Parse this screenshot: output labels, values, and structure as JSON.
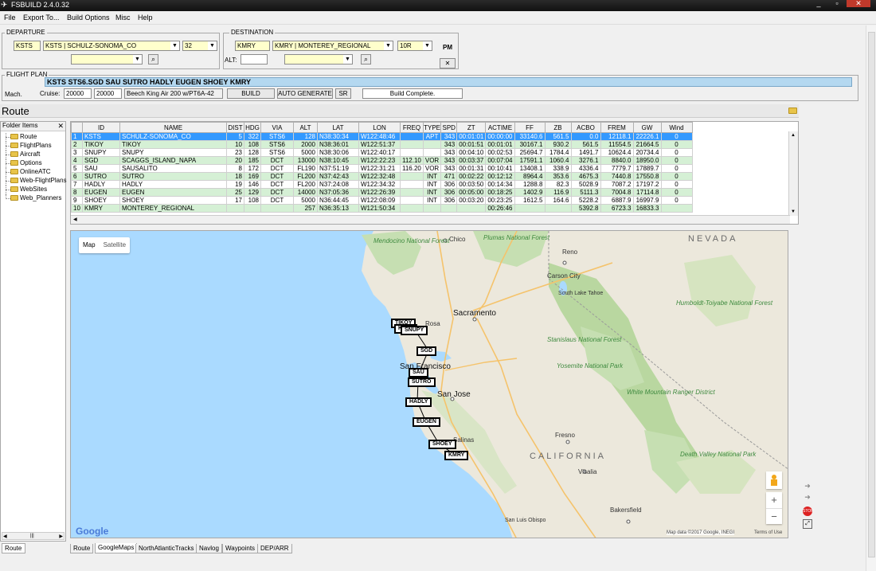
{
  "window": {
    "title": "FSBUILD 2.4.0.32"
  },
  "menu": [
    "File",
    "Export To...",
    "Build Options",
    "Misc",
    "Help"
  ],
  "departure": {
    "legend": "DEPARTURE",
    "code": "KSTS",
    "airport": "KSTS | SCHULZ-SONOMA_CO",
    "runway": "32",
    "sid": ""
  },
  "destination": {
    "legend": "DESTINATION",
    "code": "KMRY",
    "airport": "KMRY | MONTEREY_REGIONAL",
    "runway": "10R",
    "star": "",
    "alt_label": "ALT:",
    "alt_value": "",
    "pm_label": "PM",
    "close_label": "✕"
  },
  "flightplan": {
    "legend": "FLIGHT PLAN",
    "route": "KSTS STS6.SGD SAU SUTRO HADLY EUGEN SHOEY KMRY",
    "mach_label": "Mach.",
    "cruise_label": "Cruise:",
    "cruise_alt1": "20000",
    "cruise_alt2": "20000",
    "aircraft": "Beech King Air 200 w/PT6A-42",
    "build_label": "BUILD",
    "autogen_label": "AUTO GENERATE",
    "sr_label": "SR",
    "status": "Build Complete."
  },
  "route_panel": {
    "title": "Route"
  },
  "folders": {
    "header": "Folder Items",
    "close": "✕",
    "items": [
      "Route",
      "FlightPlans",
      "Aircraft",
      "Options",
      "OnlineATC",
      "Web-FlightPlans",
      "WebSites",
      "Web_Planners"
    ],
    "bottom_tab": "Route"
  },
  "nav_table": {
    "columns": [
      "",
      "ID",
      "NAME",
      "DIST",
      "HDG",
      "VIA",
      "ALT",
      "LAT",
      "LON",
      "FREQ",
      "TYPE",
      "SPD",
      "ZT",
      "ACTIME",
      "FF",
      "ZB",
      "ACBO",
      "FREM",
      "GW",
      "Wind"
    ],
    "rows": [
      [
        "1",
        "KSTS",
        "SCHULZ-SONOMA_CO",
        "5",
        "322",
        "STS6",
        "128",
        "N38:30:34",
        "W122:48:46",
        "",
        "APT",
        "343",
        "00:01:01",
        "00:00:00",
        "33140.6",
        "561.5",
        "0.0",
        "12118.1",
        "22226.1",
        "0"
      ],
      [
        "2",
        "TIKOY",
        "TIKOY",
        "10",
        "108",
        "STS6",
        "2000",
        "N38:36:01",
        "W122:51:37",
        "",
        "",
        "343",
        "00:01:51",
        "00:01:01",
        "30167.1",
        "930.2",
        "561.5",
        "11554.5",
        "21664.5",
        "0"
      ],
      [
        "3",
        "SNUPY",
        "SNUPY",
        "23",
        "128",
        "STS6",
        "5000",
        "N38:30:06",
        "W122:40:17",
        "",
        "",
        "343",
        "00:04:10",
        "00:02:53",
        "25694.7",
        "1784.4",
        "1491.7",
        "10624.4",
        "20734.4",
        "0"
      ],
      [
        "4",
        "SGD",
        "SCAGGS_ISLAND_NAPA",
        "20",
        "185",
        "DCT",
        "13000",
        "N38:10:45",
        "W122:22:23",
        "112.10",
        "VOR",
        "343",
        "00:03:37",
        "00:07:04",
        "17591.1",
        "1060.4",
        "3276.1",
        "8840.0",
        "18950.0",
        "0"
      ],
      [
        "5",
        "SAU",
        "SAUSALITO",
        "8",
        "172",
        "DCT",
        "FL190",
        "N37:51:19",
        "W122:31:21",
        "116.20",
        "VOR",
        "343",
        "00:01:31",
        "00:10:41",
        "13408.1",
        "338.9",
        "4336.4",
        "7779.7",
        "17889.7",
        "0"
      ],
      [
        "6",
        "SUTRO",
        "SUTRO",
        "18",
        "169",
        "DCT",
        "FL200",
        "N37:42:43",
        "W122:32:48",
        "",
        "INT",
        "471",
        "00:02:22",
        "00:12:12",
        "8964.4",
        "353.6",
        "4675.3",
        "7440.8",
        "17550.8",
        "0"
      ],
      [
        "7",
        "HADLY",
        "HADLY",
        "19",
        "146",
        "DCT",
        "FL200",
        "N37:24:08",
        "W122:34:32",
        "",
        "INT",
        "306",
        "00:03:50",
        "00:14:34",
        "1288.8",
        "82.3",
        "5028.9",
        "7087.2",
        "17197.2",
        "0"
      ],
      [
        "8",
        "EUGEN",
        "EUGEN",
        "25",
        "129",
        "DCT",
        "14000",
        "N37:05:36",
        "W122:26:39",
        "",
        "INT",
        "306",
        "00:05:00",
        "00:18:25",
        "1402.9",
        "116.9",
        "5111.3",
        "7004.8",
        "17114.8",
        "0"
      ],
      [
        "9",
        "SHOEY",
        "SHOEY",
        "17",
        "108",
        "DCT",
        "5000",
        "N36:44:45",
        "W122:08:09",
        "",
        "INT",
        "306",
        "00:03:20",
        "00:23:25",
        "1612.5",
        "164.6",
        "5228.2",
        "6887.9",
        "16997.9",
        "0"
      ],
      [
        "10",
        "KMRY",
        "MONTEREY_REGIONAL",
        "",
        "",
        "",
        "257",
        "N36:35:13",
        "W121:50:34",
        "",
        "",
        "",
        "",
        "00:26:46",
        "",
        "",
        "5392.8",
        "6723.3",
        "16833.3",
        ""
      ]
    ]
  },
  "map": {
    "toggle": [
      "Map",
      "Satellite"
    ],
    "waypoints": [
      "TIKOY",
      "KSTS",
      "SNUPY",
      "SGD",
      "SAU",
      "SUTRO",
      "HADLY",
      "EUGEN",
      "SHOEY",
      "KMRY"
    ],
    "places": {
      "sacramento": "Sacramento",
      "san_francisco": "San Francisco",
      "san_jose": "San Jose",
      "nevada": "NEVADA",
      "california": "CALIFORNIA",
      "reno": "Reno",
      "carson_city": "Carson City",
      "south_lake": "South Lake Tahoe",
      "chico": "Chico",
      "fresno": "Fresno",
      "visalia": "Visalia",
      "bakersfield": "Bakersfield",
      "salinas": "Salinas",
      "san_luis": "San Luis Obispo",
      "mendocino": "Mendocino National Forest",
      "plumas": "Plumas National Forest",
      "stanislaus": "Stanislaus National Forest",
      "yosemite": "Yosemite National Park",
      "humboldt": "Humboldt-Toiyabe National Forest",
      "white_mountain": "White Mountain Ranger District",
      "death_valley": "Death Valley National Park",
      "rosa": "Rosa"
    },
    "copyright": "Map data ©2017 Google, INEGI",
    "terms": "Terms of Use",
    "google": "Google",
    "zoom_in": "+",
    "zoom_out": "−"
  },
  "tabs": [
    "Route",
    "GoogleMaps",
    "NorthAtlanticTracks",
    "Navlog",
    "Waypoints",
    "DEP/ARR"
  ],
  "active_tab": "GoogleMaps",
  "colors": {
    "selected": "#3399ff",
    "alt_row": "#d5f0d5",
    "field": "#ffffcc",
    "water": "#aadaff",
    "land": "#ece8dc",
    "forest": "#c6dfb2"
  }
}
